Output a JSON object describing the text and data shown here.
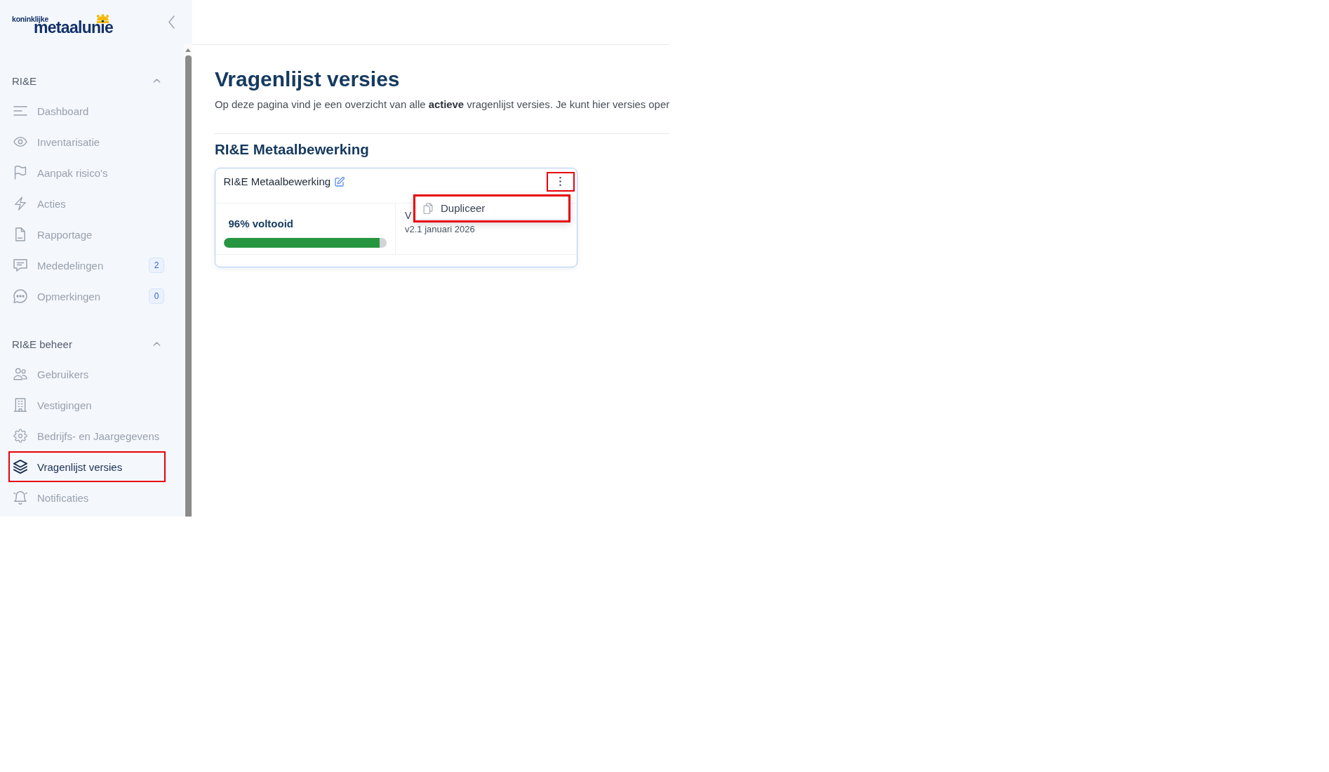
{
  "sidebar": {
    "logo": {
      "prefix": "koninklijke",
      "wordmark": "metaalunie"
    },
    "sections": [
      {
        "title": "RI&E",
        "expanded": true,
        "items": [
          {
            "label": "Dashboard",
            "selected": false,
            "highlighted": false
          },
          {
            "label": "Inventarisatie",
            "selected": false,
            "highlighted": false
          },
          {
            "label": "Aanpak risico's",
            "selected": false,
            "highlighted": false
          },
          {
            "label": "Acties",
            "selected": false,
            "highlighted": false
          },
          {
            "label": "Rapportage",
            "selected": false,
            "highlighted": false
          },
          {
            "label": "Mededelingen",
            "selected": false,
            "highlighted": false,
            "badge": "2"
          },
          {
            "label": "Opmerkingen",
            "selected": false,
            "highlighted": false,
            "badge": "0"
          }
        ]
      },
      {
        "title": "RI&E beheer",
        "expanded": true,
        "items": [
          {
            "label": "Gebruikers",
            "selected": false,
            "highlighted": false
          },
          {
            "label": "Vestigingen",
            "selected": false,
            "highlighted": false
          },
          {
            "label": "Bedrijfs- en Jaargegevens",
            "selected": false,
            "highlighted": false
          },
          {
            "label": "Vragenlijst versies",
            "selected": true,
            "highlighted": true
          },
          {
            "label": "Notificaties",
            "selected": false,
            "highlighted": false
          }
        ]
      }
    ]
  },
  "page": {
    "title": "Vragenlijst versies",
    "description": "Op deze pagina vind je een overzicht van alle **actieve** vragenlijst versies. Je kunt hier versies oper",
    "groups": [
      {
        "title": "RI&E Metaalbewerking",
        "cards": [
          {
            "title": "RI&E Metaalbewerking",
            "more_button": {
              "highlighted": true
            },
            "menu": {
              "open": true,
              "highlighted": true,
              "items": [
                {
                  "label": "Dupliceer"
                }
              ]
            },
            "progress": {
              "label": "96% voltooid",
              "level": 0.96
            },
            "version": {
              "label": "V",
              "value": "v2.1 januari 2026"
            }
          }
        ]
      }
    ]
  }
}
